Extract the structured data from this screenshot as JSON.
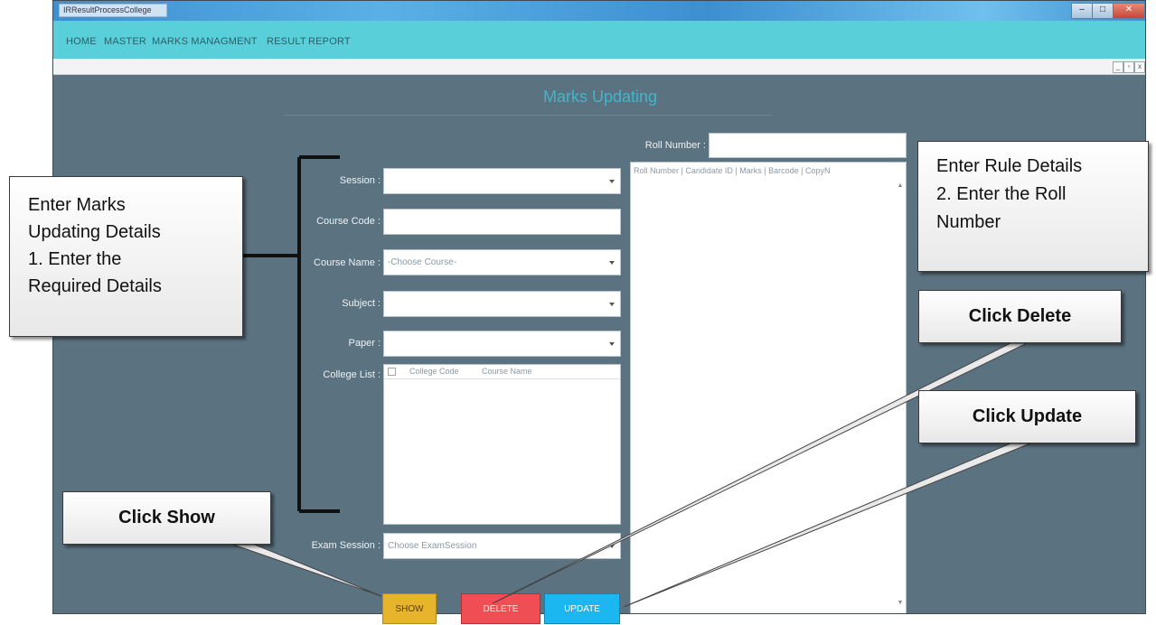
{
  "window": {
    "title": "IRResultProcessCollege",
    "buttons": {
      "minimize": "–",
      "maximize": "□",
      "close": "✕"
    }
  },
  "menu": {
    "items": [
      "HOME",
      "MASTER",
      "MARKS MANAGMENT",
      "RESULT",
      "REPORT"
    ]
  },
  "mdi_buttons": [
    "_",
    "▫",
    "x"
  ],
  "page": {
    "heading": "Marks Updating"
  },
  "form": {
    "session": {
      "label": "Session :",
      "value": ""
    },
    "course_code": {
      "label": "Course Code :",
      "value": ""
    },
    "course_name": {
      "label": "Course Name :",
      "value": "-Choose Course-"
    },
    "subject": {
      "label": "Subject :",
      "value": ""
    },
    "paper": {
      "label": "Paper :",
      "value": ""
    },
    "college_list": {
      "label": "College List :",
      "columns": [
        "College Code",
        "Course Name"
      ]
    },
    "exam_session": {
      "label": "Exam Session :",
      "value": "Choose ExamSession"
    }
  },
  "roll": {
    "label": "Roll Number :",
    "value": "",
    "columns": [
      "Roll Number",
      "Candidate ID",
      "Marks",
      "Barcode",
      "CopyN"
    ]
  },
  "buttons": {
    "show": "SHOW",
    "delete": "DELETE",
    "update": "UPDATE"
  },
  "callouts": {
    "marks": [
      "Enter Marks",
      "Updating Details",
      "1. Enter the",
      "Required Details"
    ],
    "rule": [
      "Enter Rule Details",
      "2. Enter the Roll",
      "Number"
    ],
    "delete": "Click Delete",
    "update": "Click Update",
    "show": "Click Show"
  },
  "colors": {
    "menu_bar": "#58cfd9",
    "form_bg": "#5b7280",
    "heading": "#3fb6cc",
    "show_button": "#e6b52b",
    "delete_button": "#ef4f54",
    "update_button": "#1ab7f0"
  }
}
